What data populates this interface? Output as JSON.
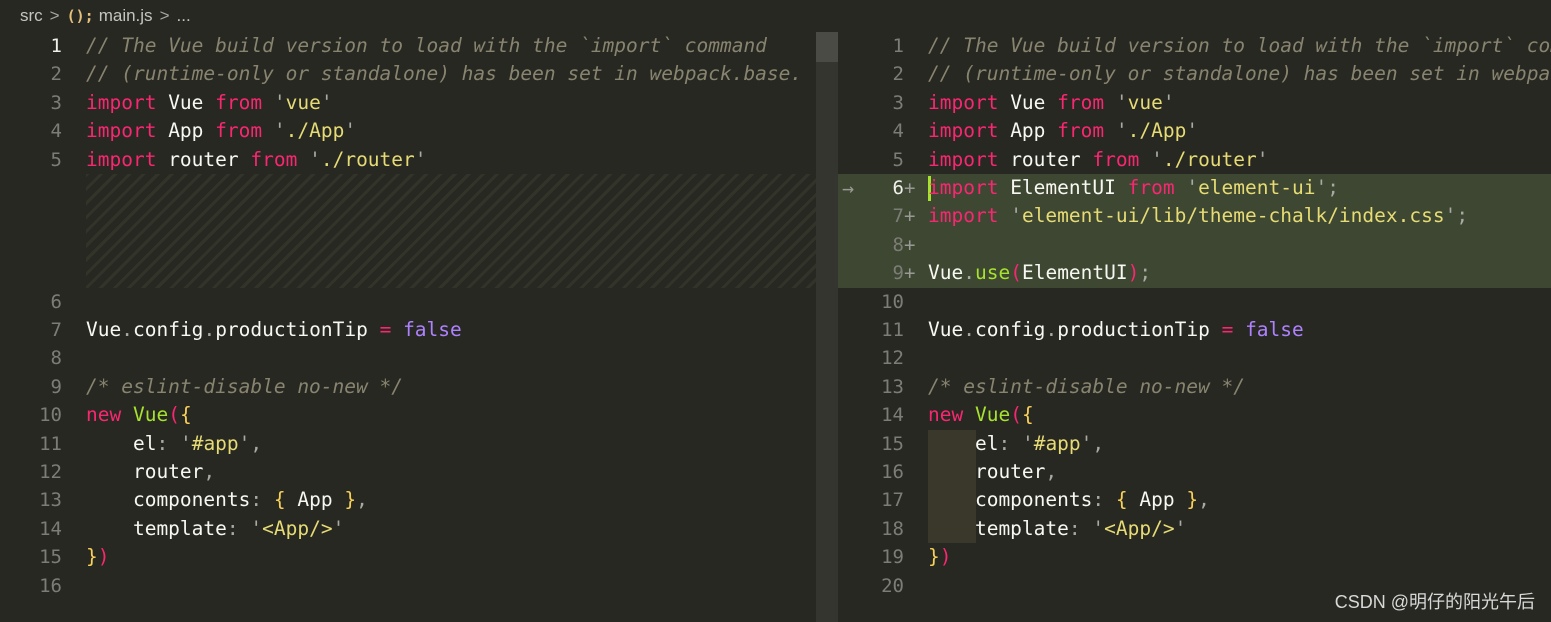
{
  "breadcrumb": {
    "folder": "src",
    "sep": ">",
    "file_icon": "();",
    "file": "main.js",
    "more": "..."
  },
  "left": {
    "lines": [
      {
        "n": "1",
        "tokens": [
          [
            "cm",
            "// The Vue build version to load with the `import` command"
          ]
        ]
      },
      {
        "n": "2",
        "tokens": [
          [
            "cm",
            "// (runtime-only or standalone) has been set in webpack.base."
          ]
        ]
      },
      {
        "n": "3",
        "tokens": [
          [
            "kw",
            "import"
          ],
          [
            "plain",
            " Vue "
          ],
          [
            "kw",
            "from"
          ],
          [
            "plain",
            " "
          ],
          [
            "pun",
            "'"
          ],
          [
            "str",
            "vue"
          ],
          [
            "pun",
            "'"
          ]
        ]
      },
      {
        "n": "4",
        "tokens": [
          [
            "kw",
            "import"
          ],
          [
            "plain",
            " App "
          ],
          [
            "kw",
            "from"
          ],
          [
            "plain",
            " "
          ],
          [
            "pun",
            "'"
          ],
          [
            "str",
            "./App"
          ],
          [
            "pun",
            "'"
          ]
        ]
      },
      {
        "n": "5",
        "tokens": [
          [
            "kw",
            "import"
          ],
          [
            "plain",
            " router "
          ],
          [
            "kw",
            "from"
          ],
          [
            "plain",
            " "
          ],
          [
            "pun",
            "'"
          ],
          [
            "str",
            "./router"
          ],
          [
            "pun",
            "'"
          ]
        ]
      },
      {
        "n": "6",
        "tokens": []
      },
      {
        "n": "7",
        "tokens": [
          [
            "plain",
            "Vue"
          ],
          [
            "pun",
            "."
          ],
          [
            "plain",
            "config"
          ],
          [
            "pun",
            "."
          ],
          [
            "plain",
            "productionTip "
          ],
          [
            "kw",
            "="
          ],
          [
            "plain",
            " "
          ],
          [
            "bool",
            "false"
          ]
        ]
      },
      {
        "n": "8",
        "tokens": []
      },
      {
        "n": "9",
        "tokens": [
          [
            "cm",
            "/* eslint-disable no-new */"
          ]
        ]
      },
      {
        "n": "10",
        "tokens": [
          [
            "kw",
            "new"
          ],
          [
            "plain",
            " "
          ],
          [
            "fn",
            "Vue"
          ],
          [
            "par",
            "("
          ],
          [
            "brk",
            "{"
          ]
        ]
      },
      {
        "n": "11",
        "tokens": [
          [
            "plain",
            "    el"
          ],
          [
            "pun",
            ":"
          ],
          [
            "plain",
            " "
          ],
          [
            "pun",
            "'"
          ],
          [
            "str",
            "#app"
          ],
          [
            "pun",
            "'"
          ],
          [
            "pun",
            ","
          ]
        ]
      },
      {
        "n": "12",
        "tokens": [
          [
            "plain",
            "    router"
          ],
          [
            "pun",
            ","
          ]
        ]
      },
      {
        "n": "13",
        "tokens": [
          [
            "plain",
            "    components"
          ],
          [
            "pun",
            ":"
          ],
          [
            "plain",
            " "
          ],
          [
            "brk",
            "{"
          ],
          [
            "plain",
            " App "
          ],
          [
            "brk",
            "}"
          ],
          [
            "pun",
            ","
          ]
        ]
      },
      {
        "n": "14",
        "tokens": [
          [
            "plain",
            "    template"
          ],
          [
            "pun",
            ":"
          ],
          [
            "plain",
            " "
          ],
          [
            "pun",
            "'"
          ],
          [
            "str",
            "<App/>"
          ],
          [
            "pun",
            "'"
          ]
        ]
      },
      {
        "n": "15",
        "tokens": [
          [
            "brk",
            "}"
          ],
          [
            "par",
            ")"
          ]
        ]
      },
      {
        "n": "16",
        "tokens": []
      }
    ]
  },
  "right": {
    "lines": [
      {
        "n": "1",
        "tokens": [
          [
            "cm",
            "// The Vue build version to load with the `import` command"
          ]
        ]
      },
      {
        "n": "2",
        "tokens": [
          [
            "cm",
            "// (runtime-only or standalone) has been set in webpack.base.conf with an alias."
          ]
        ]
      },
      {
        "n": "3",
        "tokens": [
          [
            "kw",
            "import"
          ],
          [
            "plain",
            " Vue "
          ],
          [
            "kw",
            "from"
          ],
          [
            "plain",
            " "
          ],
          [
            "pun",
            "'"
          ],
          [
            "str",
            "vue"
          ],
          [
            "pun",
            "'"
          ]
        ]
      },
      {
        "n": "4",
        "tokens": [
          [
            "kw",
            "import"
          ],
          [
            "plain",
            " App "
          ],
          [
            "kw",
            "from"
          ],
          [
            "plain",
            " "
          ],
          [
            "pun",
            "'"
          ],
          [
            "str",
            "./App"
          ],
          [
            "pun",
            "'"
          ]
        ]
      },
      {
        "n": "5",
        "tokens": [
          [
            "kw",
            "import"
          ],
          [
            "plain",
            " router "
          ],
          [
            "kw",
            "from"
          ],
          [
            "plain",
            " "
          ],
          [
            "pun",
            "'"
          ],
          [
            "str",
            "./router"
          ],
          [
            "pun",
            "'"
          ]
        ]
      },
      {
        "n": "6",
        "plus": "+",
        "tokens": [
          [
            "kw",
            "import"
          ],
          [
            "plain",
            " ElementUI "
          ],
          [
            "kw",
            "from"
          ],
          [
            "plain",
            " "
          ],
          [
            "pun",
            "'"
          ],
          [
            "str",
            "element-ui"
          ],
          [
            "pun",
            "'"
          ],
          [
            "pun",
            ";"
          ]
        ]
      },
      {
        "n": "7",
        "plus": "+",
        "tokens": [
          [
            "kw",
            "import"
          ],
          [
            "plain",
            " "
          ],
          [
            "pun",
            "'"
          ],
          [
            "str",
            "element-ui/lib/theme-chalk/index.css"
          ],
          [
            "pun",
            "'"
          ],
          [
            "pun",
            ";"
          ]
        ]
      },
      {
        "n": "8",
        "plus": "+",
        "tokens": []
      },
      {
        "n": "9",
        "plus": "+",
        "tokens": [
          [
            "plain",
            "Vue"
          ],
          [
            "pun",
            "."
          ],
          [
            "fn",
            "use"
          ],
          [
            "par",
            "("
          ],
          [
            "plain",
            "ElementUI"
          ],
          [
            "par",
            ")"
          ],
          [
            "pun",
            ";"
          ]
        ]
      },
      {
        "n": "10",
        "tokens": []
      },
      {
        "n": "11",
        "tokens": [
          [
            "plain",
            "Vue"
          ],
          [
            "pun",
            "."
          ],
          [
            "plain",
            "config"
          ],
          [
            "pun",
            "."
          ],
          [
            "plain",
            "productionTip "
          ],
          [
            "kw",
            "="
          ],
          [
            "plain",
            " "
          ],
          [
            "bool",
            "false"
          ]
        ]
      },
      {
        "n": "12",
        "tokens": []
      },
      {
        "n": "13",
        "tokens": [
          [
            "cm",
            "/* eslint-disable no-new */"
          ]
        ]
      },
      {
        "n": "14",
        "tokens": [
          [
            "kw",
            "new"
          ],
          [
            "plain",
            " "
          ],
          [
            "fn",
            "Vue"
          ],
          [
            "par",
            "("
          ],
          [
            "brk",
            "{"
          ]
        ]
      },
      {
        "n": "15",
        "tokens": [
          [
            "plain",
            "    el"
          ],
          [
            "pun",
            ":"
          ],
          [
            "plain",
            " "
          ],
          [
            "pun",
            "'"
          ],
          [
            "str",
            "#app"
          ],
          [
            "pun",
            "'"
          ],
          [
            "pun",
            ","
          ]
        ]
      },
      {
        "n": "16",
        "tokens": [
          [
            "plain",
            "    router"
          ],
          [
            "pun",
            ","
          ]
        ]
      },
      {
        "n": "17",
        "tokens": [
          [
            "plain",
            "    components"
          ],
          [
            "pun",
            ":"
          ],
          [
            "plain",
            " "
          ],
          [
            "brk",
            "{"
          ],
          [
            "plain",
            " App "
          ],
          [
            "brk",
            "}"
          ],
          [
            "pun",
            ","
          ]
        ]
      },
      {
        "n": "18",
        "tokens": [
          [
            "plain",
            "    template"
          ],
          [
            "pun",
            ":"
          ],
          [
            "plain",
            " "
          ],
          [
            "pun",
            "'"
          ],
          [
            "str",
            "<App/>"
          ],
          [
            "pun",
            "'"
          ]
        ]
      },
      {
        "n": "19",
        "tokens": [
          [
            "brk",
            "}"
          ],
          [
            "par",
            ")"
          ]
        ]
      },
      {
        "n": "20",
        "tokens": []
      }
    ]
  },
  "watermark": "CSDN @明仔的阳光午后",
  "colors": {
    "background": "#272822",
    "keyword": "#f92672",
    "string": "#e6db74",
    "function": "#a6e22e",
    "boolean": "#ae81ff",
    "comment": "#88846f",
    "added_line_bg": "#3d4731"
  }
}
